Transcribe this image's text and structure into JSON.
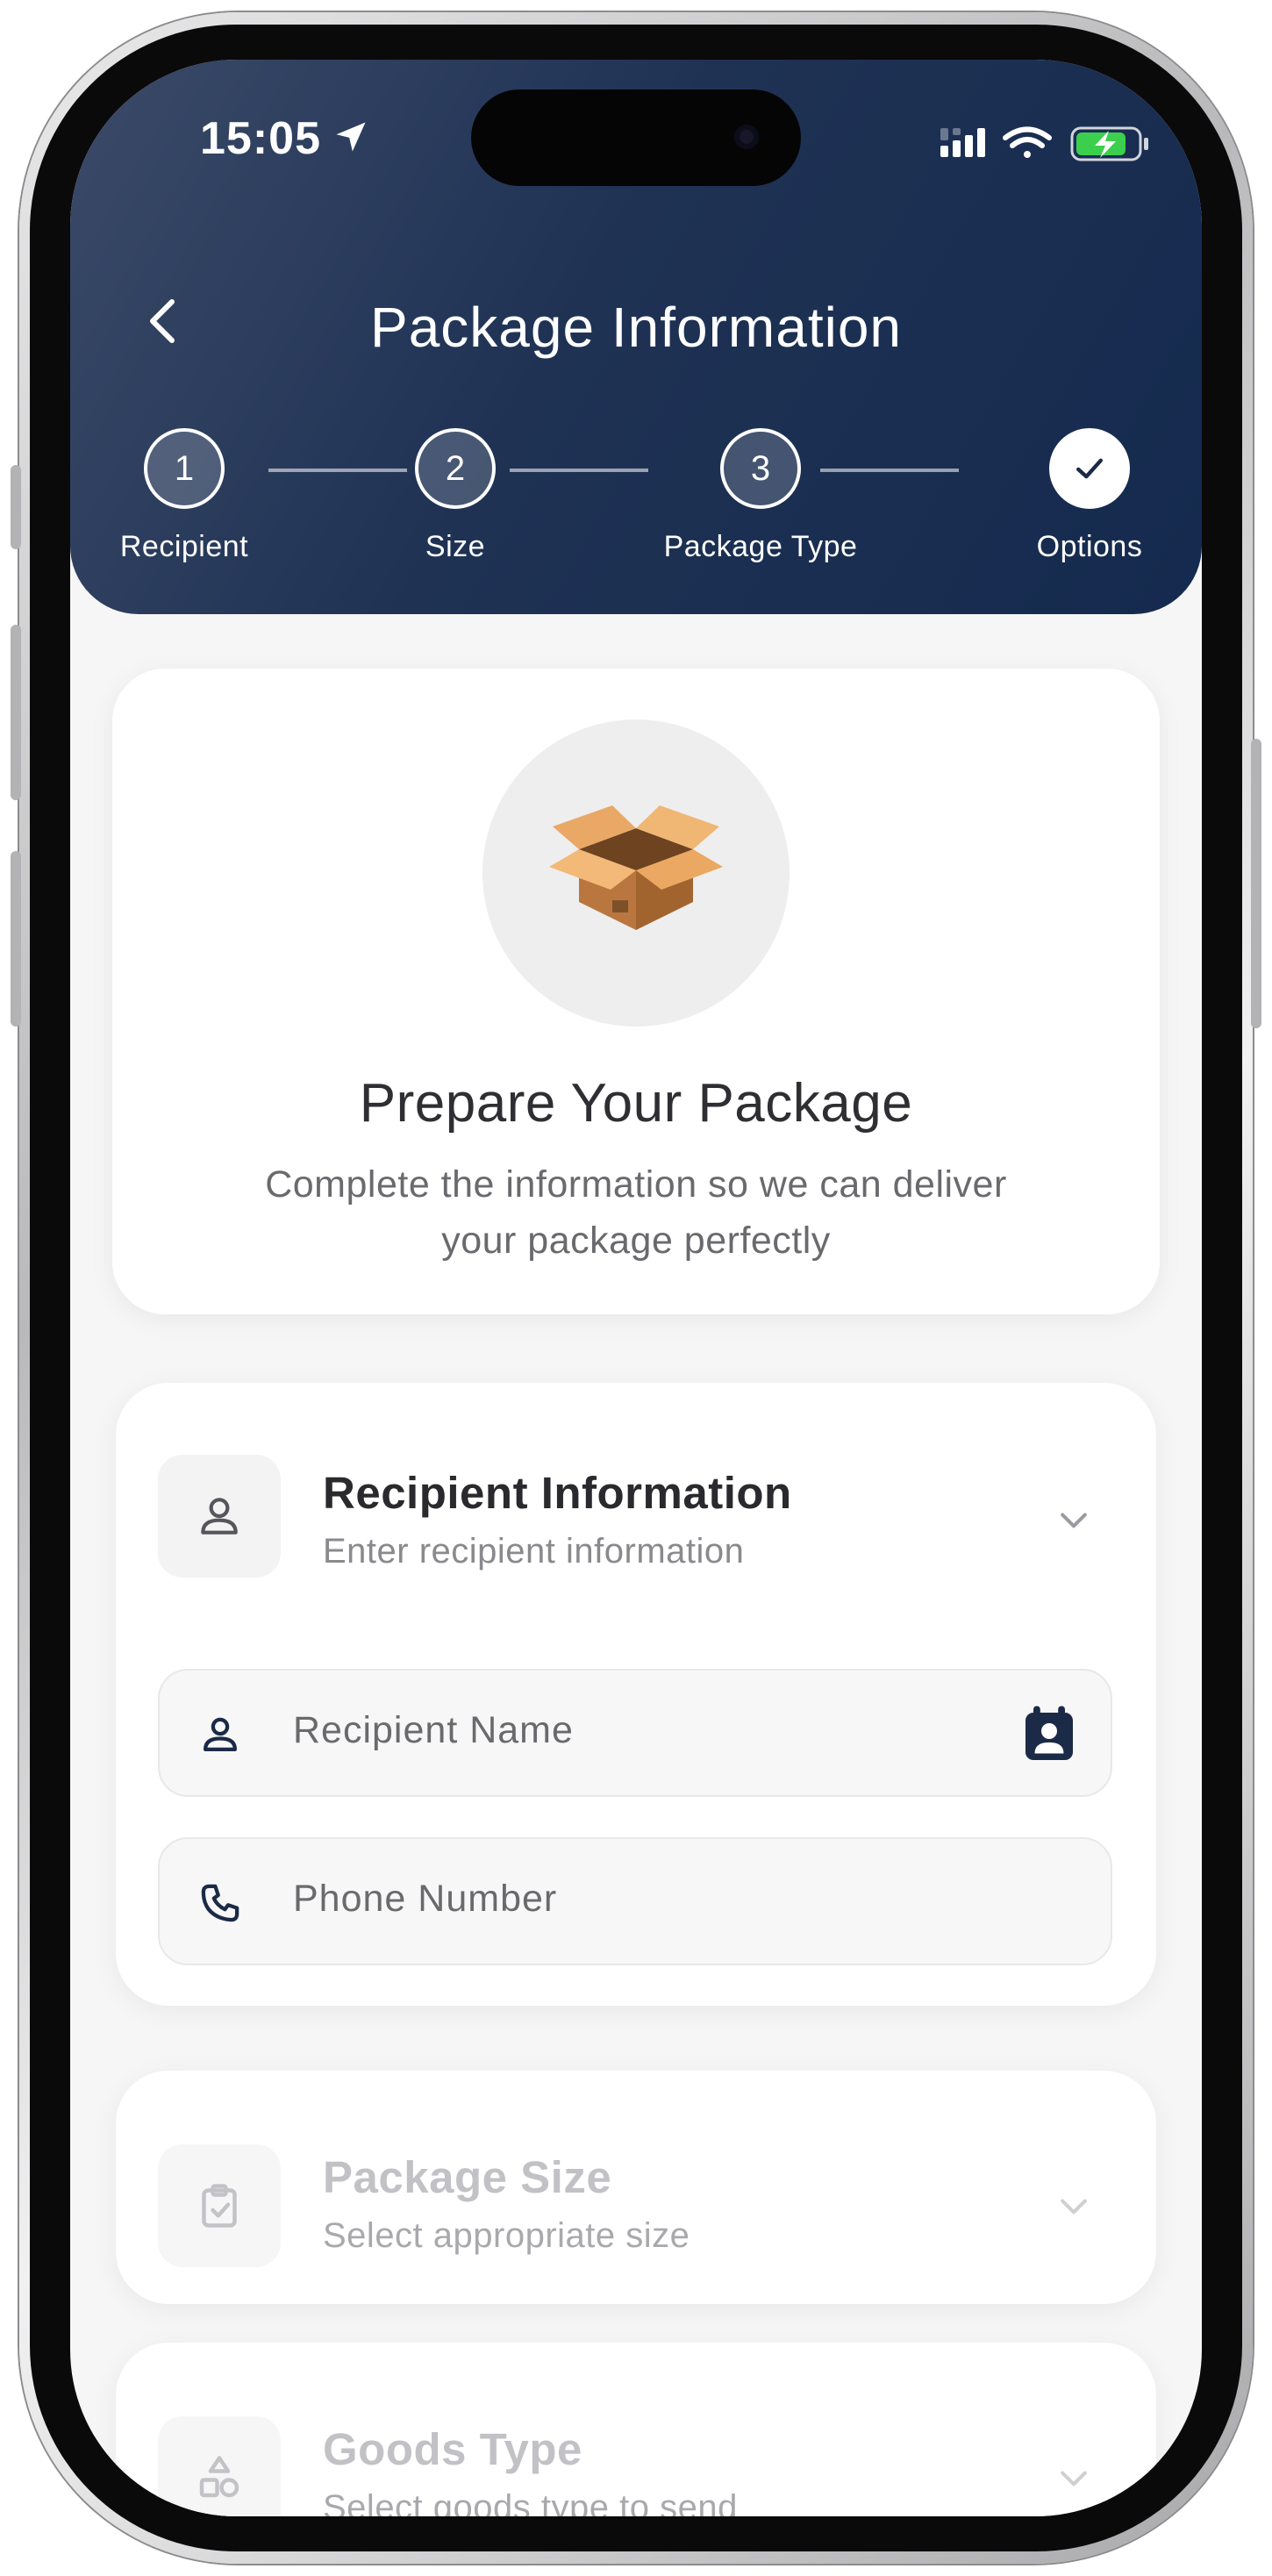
{
  "status_bar": {
    "time": "15:05",
    "icons": [
      "location-arrow-icon",
      "cellular-signal-icon",
      "wifi-icon",
      "battery-charging-icon"
    ]
  },
  "header": {
    "title": "Package Information",
    "back_icon": "chevron-left-icon"
  },
  "stepper": {
    "steps": [
      {
        "number": "1",
        "label": "Recipient"
      },
      {
        "number": "2",
        "label": "Size"
      },
      {
        "number": "3",
        "label": "Package Type"
      },
      {
        "number": "",
        "label": "Options",
        "icon": "check-icon"
      }
    ]
  },
  "hero": {
    "icon": "package-box-icon",
    "title": "Prepare Your Package",
    "subtitle_line1": "Complete the information so we can deliver",
    "subtitle_line2": "your package perfectly"
  },
  "recipient_section": {
    "title": "Recipient Information",
    "subtitle": "Enter recipient information",
    "icon": "person-icon",
    "fields": {
      "name": {
        "placeholder": "Recipient Name",
        "icon": "person-icon",
        "action_icon": "contact-book-icon"
      },
      "phone": {
        "placeholder": "Phone Number",
        "icon": "phone-icon"
      }
    }
  },
  "size_section": {
    "title": "Package Size",
    "subtitle": "Select appropriate size",
    "icon": "clipboard-check-icon"
  },
  "goods_section": {
    "title": "Goods Type",
    "subtitle": "Select goods type to send",
    "icon": "shapes-icon"
  },
  "colors": {
    "header_gradient_start": "#3b4a68",
    "header_gradient_end": "#142a4e",
    "accent_dark": "#1b2a47",
    "background": "#f6f6f6"
  }
}
